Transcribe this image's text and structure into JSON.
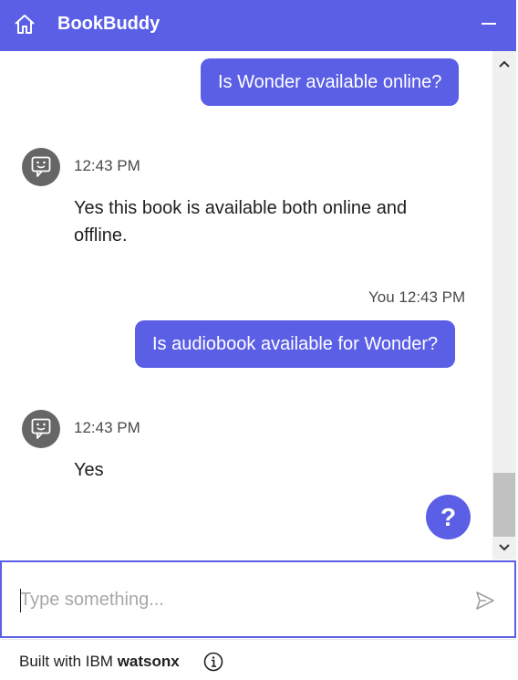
{
  "header": {
    "title": "BookBuddy",
    "home_icon": "home-icon",
    "minimize_icon": "minimize-icon",
    "background": "#5b5fe6"
  },
  "messages": {
    "user1": {
      "text": "Is Wonder available online?"
    },
    "bot1": {
      "timestamp": "12:43 PM",
      "text": "Yes this book is available both online and offline."
    },
    "user2": {
      "meta": "You 12:43 PM",
      "text": "Is audiobook available for Wonder?"
    },
    "bot2": {
      "timestamp": "12:43 PM",
      "text": "Yes"
    }
  },
  "help_button": {
    "label": "?"
  },
  "input": {
    "placeholder": "Type something...",
    "value": ""
  },
  "footer": {
    "prefix": "Built with IBM ",
    "brand": "watsonx"
  },
  "colors": {
    "accent": "#5b5fe6",
    "avatar": "#666666",
    "scrollbar_track": "#f0f0f0",
    "scrollbar_thumb": "#c1c1c1"
  }
}
